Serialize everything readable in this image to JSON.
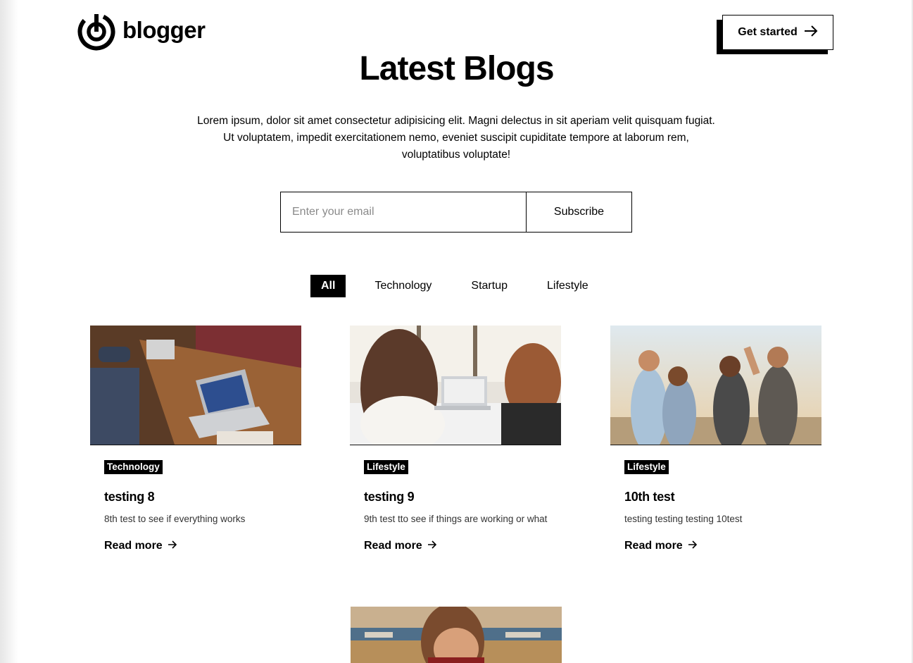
{
  "brand": {
    "name": "blogger"
  },
  "header": {
    "cta_label": "Get started",
    "cta_icon": "arrow-right-icon"
  },
  "hero": {
    "title": "Latest Blogs",
    "description": "Lorem ipsum, dolor sit amet consectetur adipisicing elit. Magni delectus in sit aperiam velit quisquam fugiat. Ut voluptatem, impedit exercitationem nemo, eveniet suscipit cupiditate tempore at laborum rem, voluptatibus voluptate!"
  },
  "subscribe": {
    "placeholder": "Enter your email",
    "value": "",
    "button_label": "Subscribe"
  },
  "filters": {
    "active": "All",
    "items": [
      {
        "label": "All"
      },
      {
        "label": "Technology"
      },
      {
        "label": "Startup"
      },
      {
        "label": "Lifestyle"
      }
    ]
  },
  "posts": [
    {
      "category": "Technology",
      "title": "testing 8",
      "excerpt": "8th test to see if everything works",
      "link_label": "Read more"
    },
    {
      "category": "Lifestyle",
      "title": "testing 9",
      "excerpt": "9th test tto see if things are working or what",
      "link_label": "Read more"
    },
    {
      "category": "Lifestyle",
      "title": "10th test",
      "excerpt": "testing testing testing 10test",
      "link_label": "Read more"
    }
  ],
  "colors": {
    "text": "#000000",
    "background": "#ffffff",
    "accent": "#000000"
  }
}
